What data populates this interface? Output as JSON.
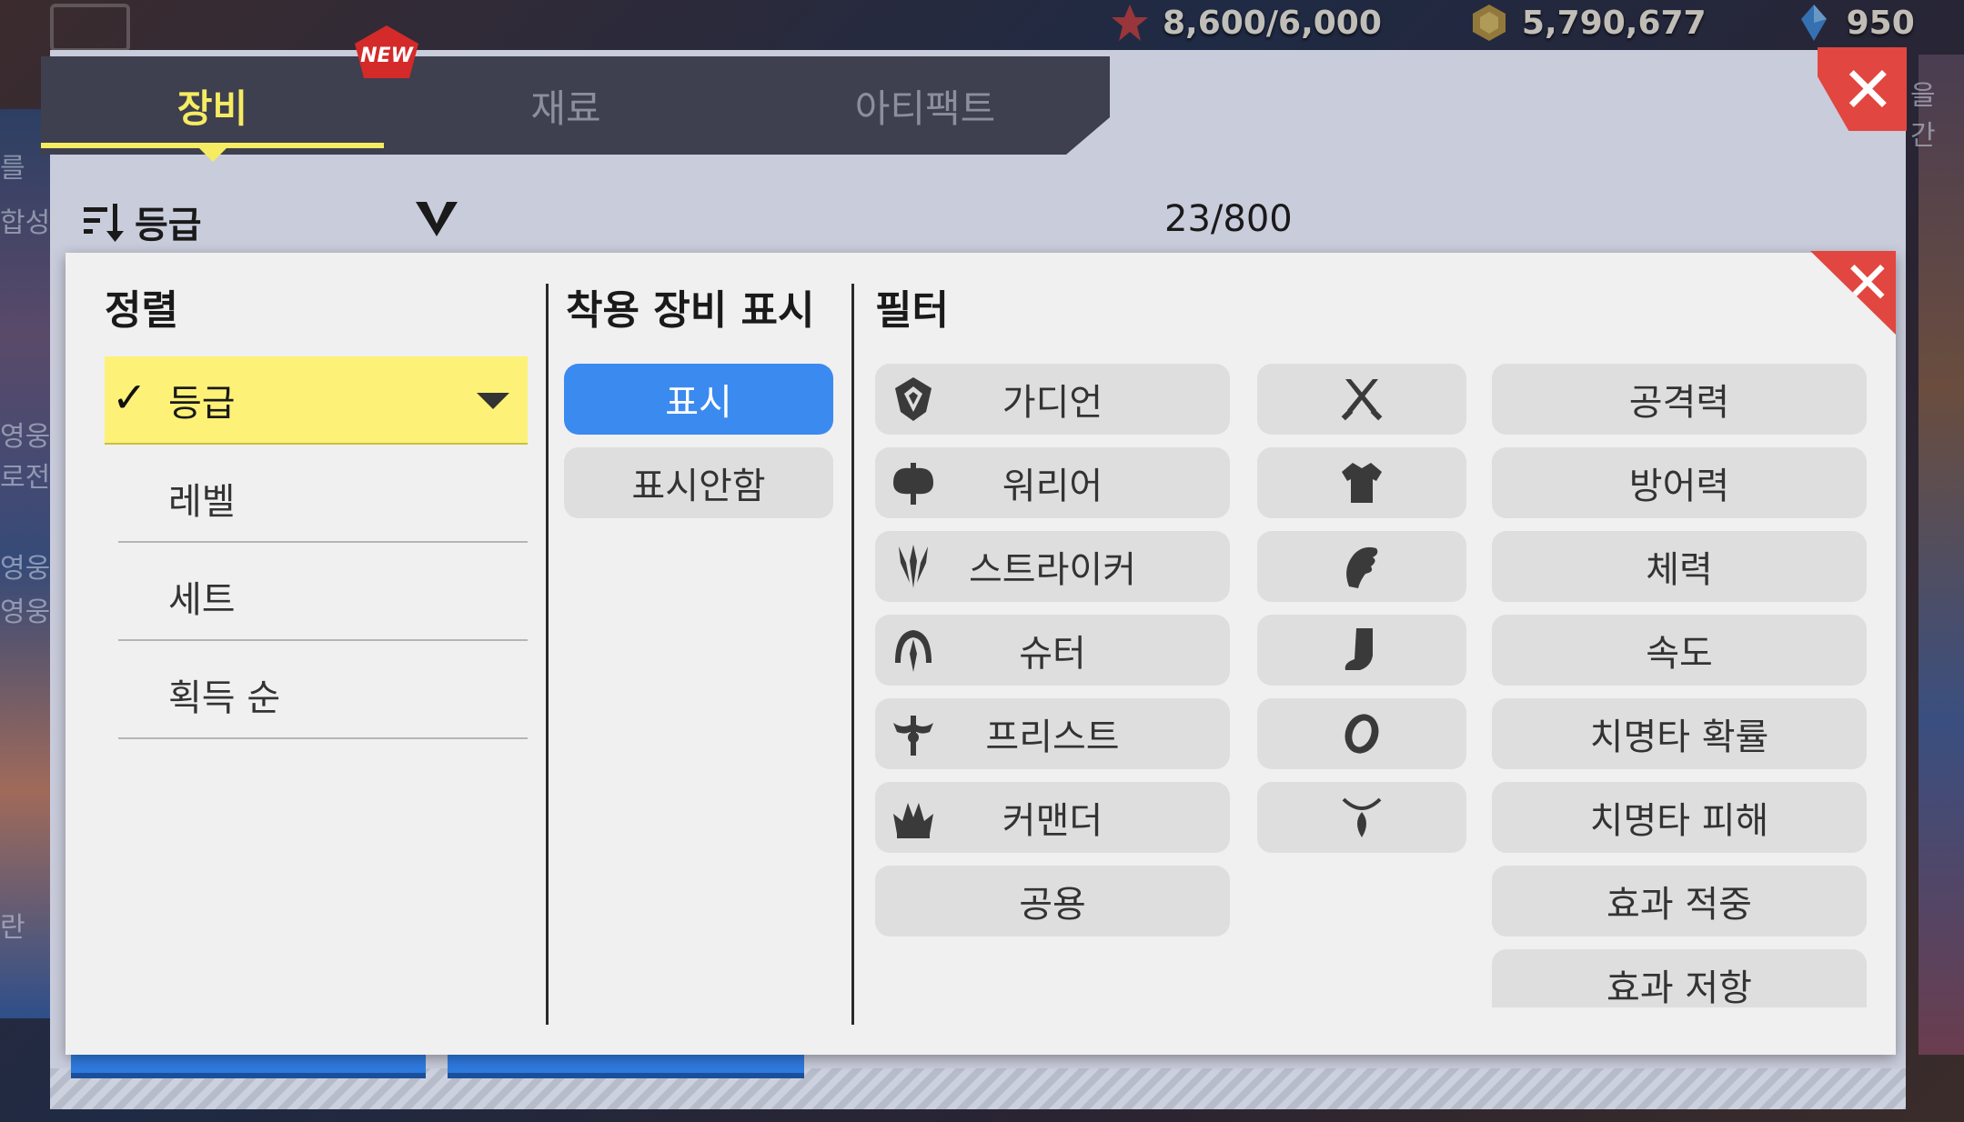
{
  "resources": [
    {
      "icon": "stamina-icon",
      "value": "8,600/6,000"
    },
    {
      "icon": "gold-icon",
      "value": "5,790,677"
    },
    {
      "icon": "crystal-icon",
      "value": "950"
    }
  ],
  "background_text": {
    "left1": "를",
    "left2": "합성",
    "left3": "영웅",
    "left4": "로전",
    "left5": "영웅",
    "left6": "영웅",
    "left7": "란",
    "right1": "을 간"
  },
  "tabs": [
    {
      "label": "장비",
      "active": true,
      "badge": "NEW"
    },
    {
      "label": "재료",
      "active": false
    },
    {
      "label": "아티팩트",
      "active": false
    }
  ],
  "sort_bar": {
    "label": "등급",
    "icon": "sort-icon"
  },
  "inventory_count": "23/800",
  "popup": {
    "sort": {
      "title": "정렬",
      "items": [
        "등급",
        "레벨",
        "세트",
        "획득 순"
      ],
      "selected": "등급"
    },
    "equipped": {
      "title": "착용 장비 표시",
      "options": [
        "표시",
        "표시안함"
      ],
      "selected": "표시"
    },
    "filter": {
      "title": "필터",
      "classes": [
        {
          "label": "가디언",
          "icon": "guardian-icon"
        },
        {
          "label": "워리어",
          "icon": "warrior-icon"
        },
        {
          "label": "스트라이커",
          "icon": "striker-icon"
        },
        {
          "label": "슈터",
          "icon": "shooter-icon"
        },
        {
          "label": "프리스트",
          "icon": "priest-icon"
        },
        {
          "label": "커맨더",
          "icon": "commander-icon"
        },
        {
          "label": "공용",
          "icon": ""
        }
      ],
      "slots": [
        "weapon-icon",
        "armor-icon",
        "gloves-icon",
        "boots-icon",
        "ring-icon",
        "necklace-icon"
      ],
      "stats": [
        "공격력",
        "방어력",
        "체력",
        "속도",
        "치명타 확률",
        "치명타 피해",
        "효과 적중",
        "효과 저항"
      ]
    }
  },
  "colors": {
    "active_tab": "#f5ec62",
    "selected_option": "#3a8af0",
    "close_button": "#e14640",
    "sort_highlight": "#fdf277"
  }
}
